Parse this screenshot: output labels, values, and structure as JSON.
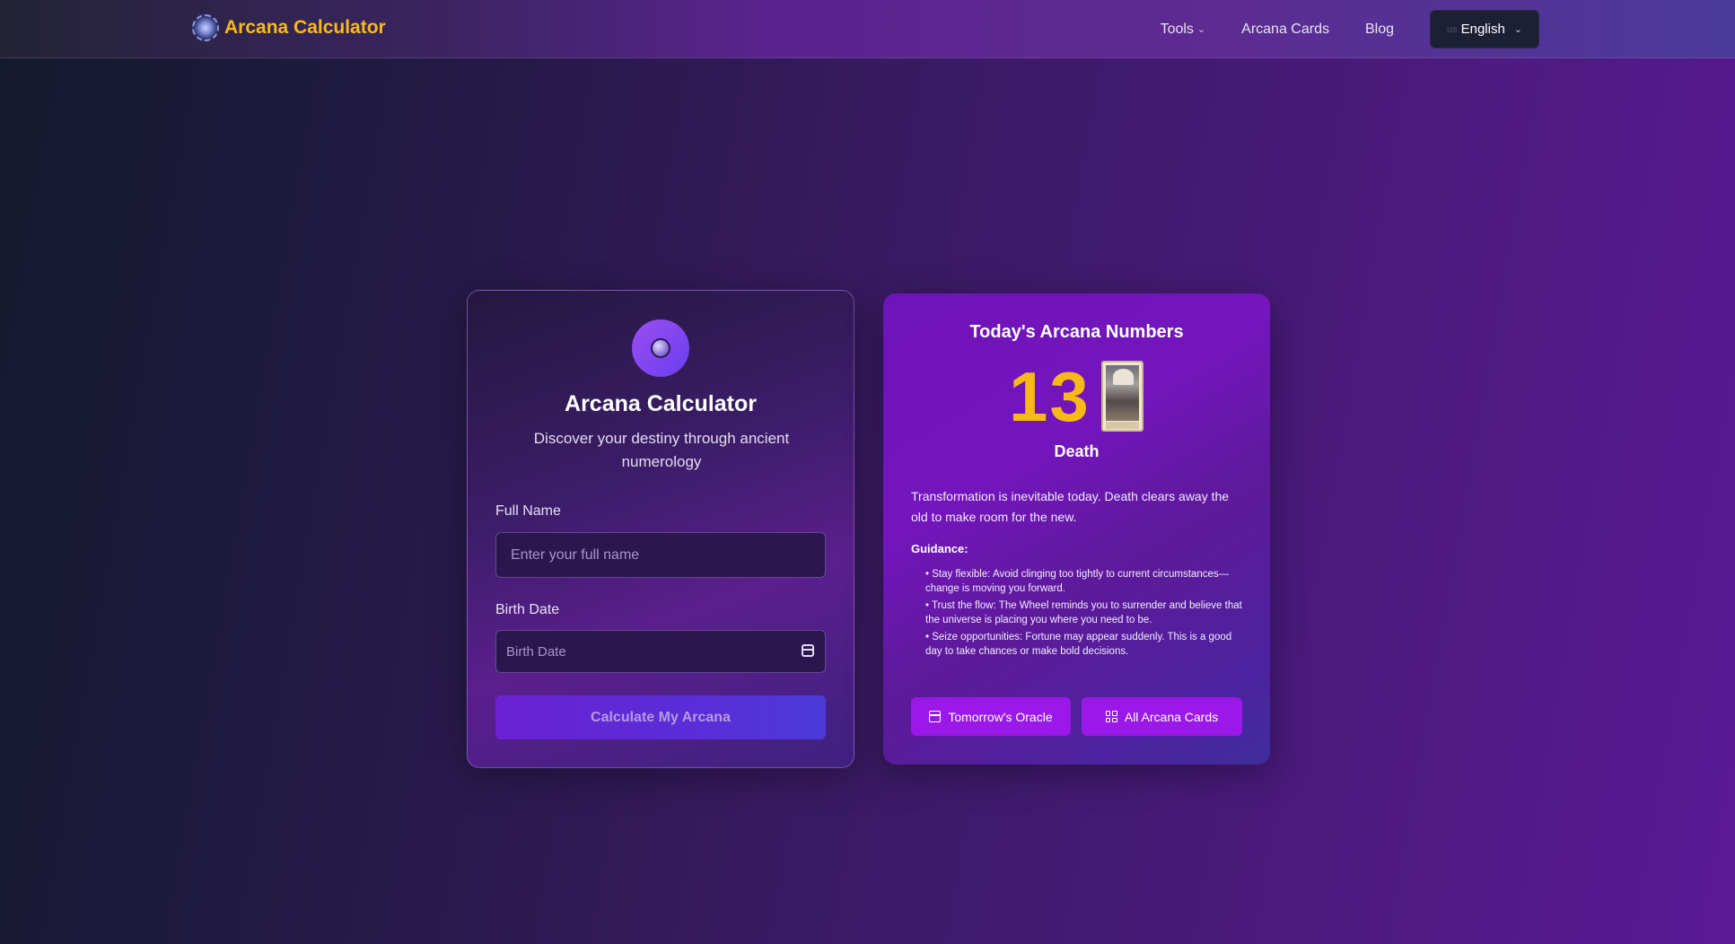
{
  "header": {
    "logo_text": "Arcana Calculator",
    "nav": [
      {
        "label": "Tools",
        "has_dropdown": true
      },
      {
        "label": "Arcana Cards"
      },
      {
        "label": "Blog"
      }
    ],
    "language": {
      "flag": "us",
      "label": "English"
    }
  },
  "calculator": {
    "title": "Arcana Calculator",
    "subtitle": "Discover your destiny through ancient numerology",
    "name_label": "Full Name",
    "name_placeholder": "Enter your full name",
    "name_value": "",
    "birth_label": "Birth Date",
    "birth_placeholder": "Birth Date",
    "submit_label": "Calculate My Arcana"
  },
  "today": {
    "title": "Today's Arcana Numbers",
    "number": "13",
    "card_name": "Death",
    "description": "Transformation is inevitable today. Death clears away the old to make room for the new.",
    "guidance_label": "Guidance:",
    "guidance": [
      "• Stay flexible: Avoid clinging too tightly to current circumstances—change is moving you forward.",
      "• Trust the flow: The Wheel reminds you to surrender and believe that the universe is placing you where you need to be.",
      "• Seize opportunities: Fortune may appear suddenly. This is a good day to take chances or make bold decisions."
    ],
    "buttons": {
      "tomorrow": "Tomorrow's Oracle",
      "all_cards": "All Arcana Cards"
    }
  },
  "colors": {
    "accent_gold": "#f7b81a",
    "button_purple": "#9b19e8"
  }
}
